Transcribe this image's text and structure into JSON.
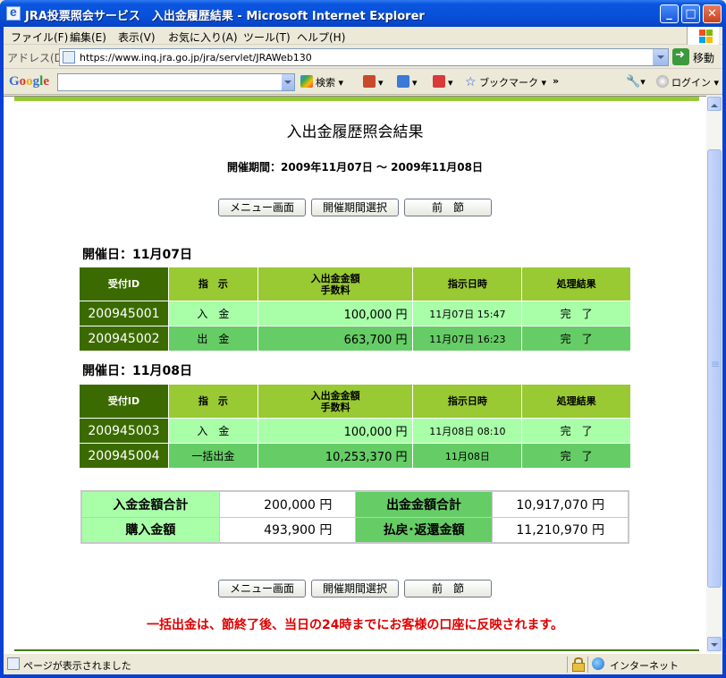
{
  "window": {
    "title": "JRA投票照会サービス　入出金履歴結果 - Microsoft Internet Explorer",
    "min": "_",
    "max": "□",
    "close": "✕"
  },
  "menu": [
    "ファイル(F)",
    "編集(E)",
    "表示(V)",
    "お気に入り(A)",
    "ツール(T)",
    "ヘルプ(H)"
  ],
  "address": {
    "label": "アドレス(D)",
    "url": "https://www.inq.jra.go.jp/jra/servlet/JRAWeb130",
    "go": "移動"
  },
  "google_toolbar": {
    "logo": "Google",
    "search_value": "",
    "search_label": "検索",
    "bookmark_label": "ブックマーク",
    "more": "»",
    "login_label": "ログイン"
  },
  "page": {
    "title": "入出金履歴照会結果",
    "period": "開催期間：2009年11月07日 ～ 2009年11月08日",
    "buttons": [
      "メニュー画面",
      "開催期間選択",
      "前　節"
    ],
    "headers": {
      "id": "受付ID",
      "instruction": "指　示",
      "amount_line1": "入出金金額",
      "amount_line2": "手数料",
      "datetime": "指示日時",
      "result": "処理結果"
    },
    "days": [
      {
        "title": "開催日：11月07日",
        "rows": [
          {
            "id": "200945001",
            "instruction": "入　金",
            "amount": "100,000 円",
            "datetime": "11月07日 15:47",
            "result": "完　了"
          },
          {
            "id": "200945002",
            "instruction": "出　金",
            "amount": "663,700 円",
            "datetime": "11月07日 16:23",
            "result": "完　了"
          }
        ]
      },
      {
        "title": "開催日：11月08日",
        "rows": [
          {
            "id": "200945003",
            "instruction": "入　金",
            "amount": "100,000 円",
            "datetime": "11月08日 08:10",
            "result": "完　了"
          },
          {
            "id": "200945004",
            "instruction": "一括出金",
            "amount": "10,253,370 円",
            "datetime": "11月08日",
            "result": "完　了"
          }
        ]
      }
    ],
    "totals": {
      "deposit_label": "入金金額合計",
      "deposit_value": "200,000 円",
      "withdraw_label": "出金金額合計",
      "withdraw_value": "10,917,070 円",
      "purchase_label": "購入金額",
      "purchase_value": "493,900 円",
      "refund_label": "払戻･返還金額",
      "refund_value": "11,210,970 円"
    },
    "notice": "一括出金は、節終了後、当日の24時までにお客様の口座に反映されます。"
  },
  "status": {
    "text": "ページが表示されました",
    "zone": "インターネット"
  }
}
